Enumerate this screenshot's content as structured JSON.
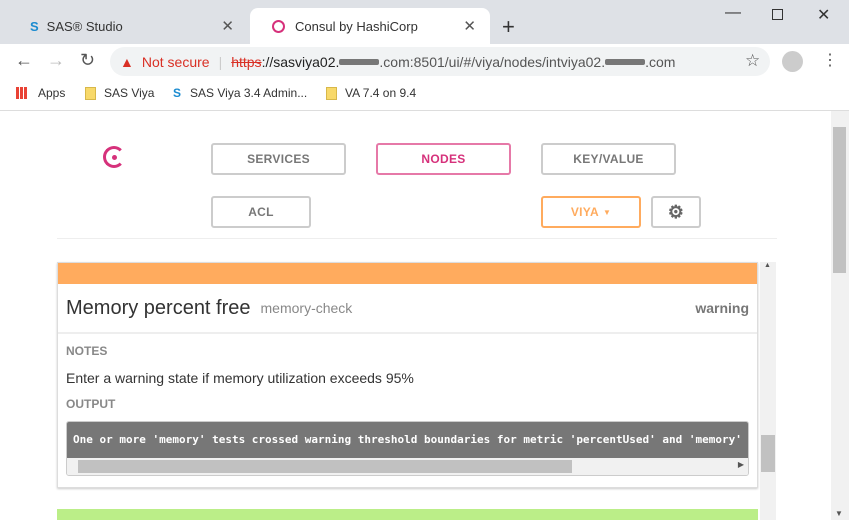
{
  "browser": {
    "tabs": [
      {
        "title": "SAS® Studio",
        "icon": "sas-icon"
      },
      {
        "title": "Consul by HashiCorp",
        "icon": "consul-icon"
      }
    ],
    "security": "Not secure",
    "url": {
      "scheme": "https",
      "p1": "://sasviya02.",
      "p2": ".com:8501/ui/#/viya/nodes/intviya02.",
      "p3": ".com"
    },
    "bookmarks": [
      "Apps",
      "SAS Viya",
      "SAS Viya 3.4 Admin...",
      "VA 7.4 on 9.4"
    ]
  },
  "nav": {
    "services": "SERVICES",
    "nodes": "NODES",
    "kv": "KEY/VALUE",
    "acl": "ACL",
    "dc": "VIYA"
  },
  "check": {
    "name": "Memory percent free",
    "id": "memory-check",
    "status": "warning",
    "notes_label": "NOTES",
    "notes": "Enter a warning state if memory utilization exceeds 95%",
    "output_label": "OUTPUT",
    "output": "One or more 'memory' tests crossed warning threshold boundaries for metric 'percentUsed' and 'memory'"
  },
  "colors": {
    "warning": "#ffab5e",
    "passing": "#bbee88",
    "consul": "#d6317b"
  }
}
